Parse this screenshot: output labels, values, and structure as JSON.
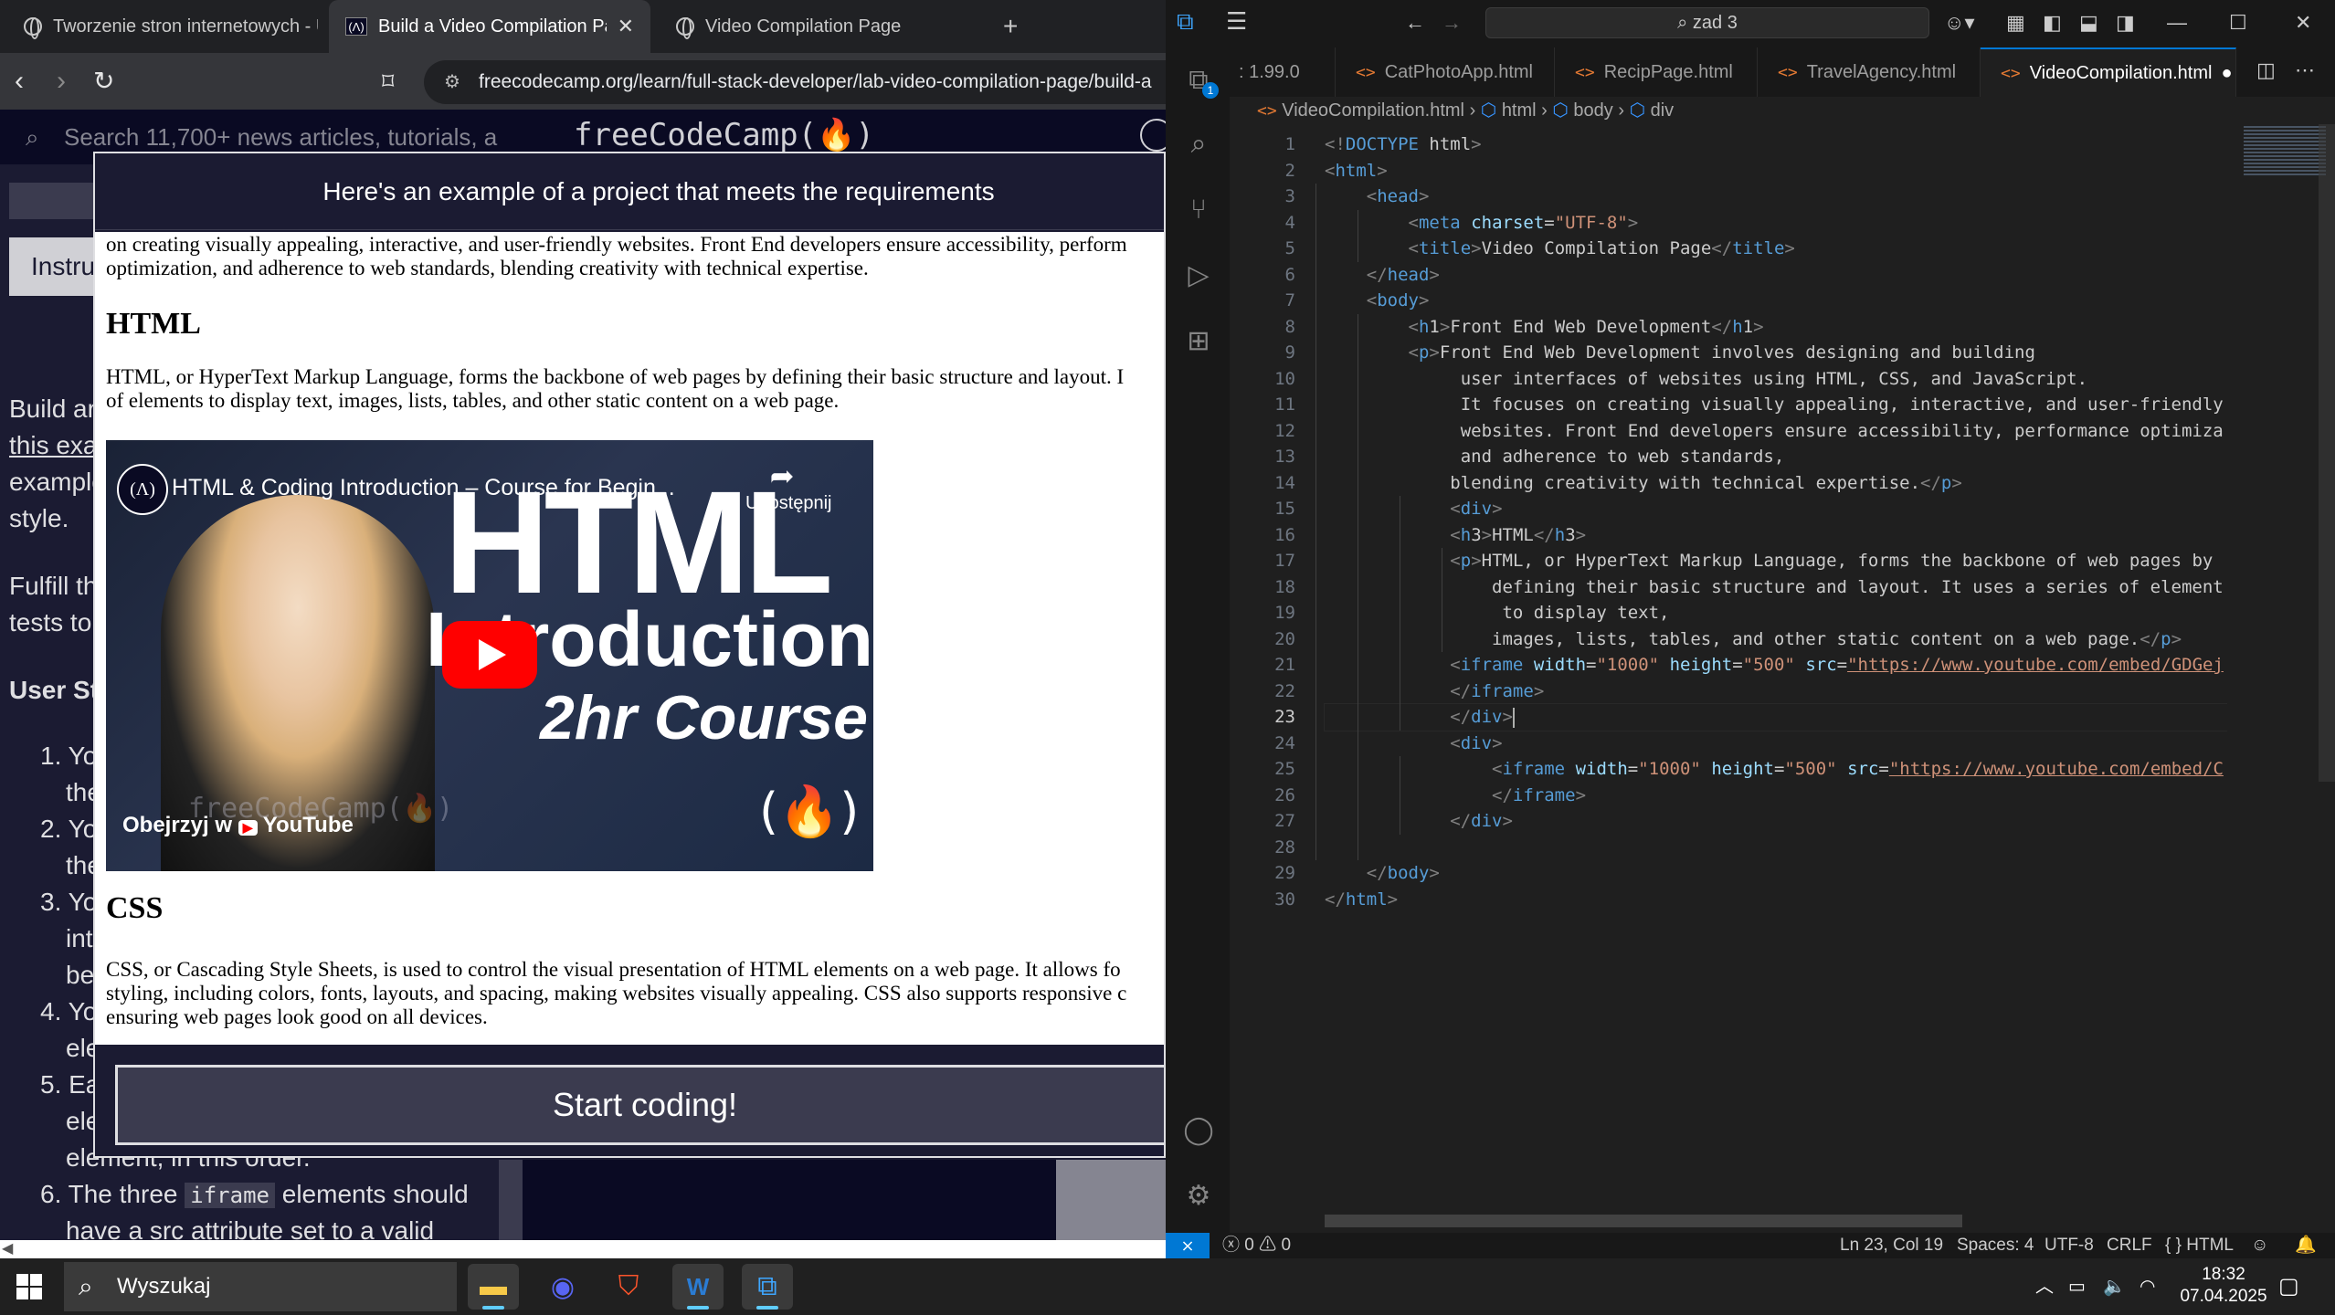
{
  "browser": {
    "tabs": [
      {
        "title": "Tworzenie stron internetowych - Ur"
      },
      {
        "title": "Build a Video Compilation Page"
      },
      {
        "title": "Video Compilation Page"
      }
    ],
    "url": "freecodecamp.org/learn/full-stack-developer/lab-video-compilation-page/build-a",
    "fcc": {
      "search_placeholder": "Search 11,700+ news articles, tutorials, a",
      "logo": "freeCodeCamp(🔥)",
      "tab_partial": "Instru"
    },
    "lesson": {
      "lines": [
        "Build ar",
        "this exa",
        "example",
        "style.",
        "Fulfill th",
        "tests to",
        "User St"
      ],
      "steps": [
        "1. Yo",
        "the",
        "2. Yo",
        "the",
        "3. Yo",
        "int",
        "be",
        "4. Yo",
        "ele",
        "5. Ea",
        "ele",
        "element, in this order."
      ],
      "step6": "6. The three",
      "step6_code": "iframe",
      "step6_rest": "elements should",
      "step6_next": "have a src attribute set to a valid"
    },
    "modal": {
      "title": "Here's an example of a project that meets the requirements",
      "intro_line1": "on creating visually appealing, interactive, and user-friendly websites. Front End developers ensure accessibility, perform",
      "intro_line2": "optimization, and adherence to web standards, blending creativity with technical expertise.",
      "h_html": "HTML",
      "p_html1": "HTML, or HyperText Markup Language, forms the backbone of web pages by defining their basic structure and layout. I",
      "p_html2": "of elements to display text, images, lists, tables, and other static content on a web page.",
      "video": {
        "title": "HTML & Coding Introduction – Course for Begin...",
        "share": "Udostępnij",
        "watch_on": "Obejrzyj w",
        "youtube": "YouTube",
        "overlay_big": "HTML",
        "overlay_mid": "Introduction",
        "overlay_sub": "2hr Course",
        "channel": "freeCodeCamp(🔥)"
      },
      "h_css": "CSS",
      "p_css1": "CSS, or Cascading Style Sheets, is used to control the visual presentation of HTML elements on a web page. It allows fo",
      "p_css2": "styling, including colors, fonts, layouts, and spacing, making websites visually appealing. CSS also supports responsive c",
      "p_css3": "ensuring web pages look good on all devices.",
      "start_button": "Start coding!"
    }
  },
  "vscode": {
    "search": "zad 3",
    "tabs": [
      {
        "label": ": 1.99.0"
      },
      {
        "label": "CatPhotoApp.html"
      },
      {
        "label": "RecipPage.html"
      },
      {
        "label": "TravelAgency.html"
      },
      {
        "label": "VideoCompilation.html"
      }
    ],
    "breadcrumb": [
      "VideoCompilation.html",
      "html",
      "body",
      "div"
    ],
    "explorer_badge": "1",
    "code": [
      "<!DOCTYPE html>",
      "<html>",
      "    <head>",
      "        <meta charset=\"UTF-8\">",
      "        <title>Video Compilation Page</title>",
      "    </head>",
      "    <body>",
      "        <h1>Front End Web Development</h1>",
      "        <p>Front End Web Development involves designing and building",
      "             user interfaces of websites using HTML, CSS, and JavaScript.",
      "             It focuses on creating visually appealing, interactive, and user-friendly",
      "             websites. Front End developers ensure accessibility, performance optimiza",
      "             and adherence to web standards,",
      "            blending creativity with technical expertise.</p>",
      "            <div>",
      "            <h3>HTML</h3>",
      "            <p>HTML, or HyperText Markup Language, forms the backbone of web pages by",
      "                defining their basic structure and layout. It uses a series of element",
      "                 to display text,",
      "                images, lists, tables, and other static content on a web page.</p>",
      "            <iframe width=\"1000\" height=\"500\" src=\"https://www.youtube.com/embed/GDGej",
      "            </iframe>",
      "            </div>",
      "            <div>",
      "                <iframe width=\"1000\" height=\"500\" src=\"https://www.youtube.com/embed/C",
      "                </iframe>",
      "            </div>",
      "",
      "    </body>",
      "</html>"
    ],
    "status": {
      "errors": "0",
      "warnings": "0",
      "position": "Ln 23, Col 19",
      "spaces": "Spaces: 4",
      "encoding": "UTF-8",
      "eol": "CRLF",
      "language": "HTML"
    }
  },
  "taskbar": {
    "search": "Wyszukaj",
    "time": "18:32",
    "date": "07.04.2025"
  }
}
